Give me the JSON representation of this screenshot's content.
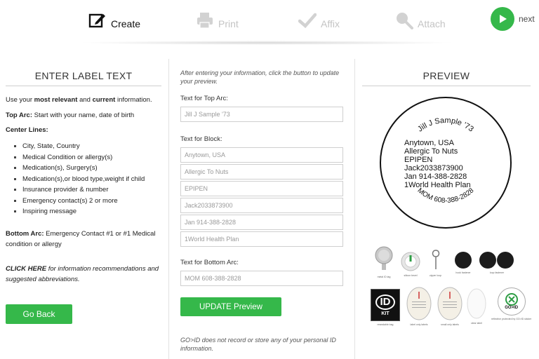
{
  "steps": [
    {
      "label": "Create",
      "icon": "edit-icon",
      "state": "active"
    },
    {
      "label": "Print",
      "icon": "printer-icon",
      "state": "inactive"
    },
    {
      "label": "Affix",
      "icon": "checkmark-icon",
      "state": "inactive"
    },
    {
      "label": "Attach",
      "icon": "magnifier-icon",
      "state": "inactive"
    }
  ],
  "next": {
    "label": "next",
    "icon": "play-arrow-icon",
    "color": "#35b84a"
  },
  "left": {
    "title": "ENTER LABEL TEXT",
    "intro": {
      "pre": "Use your ",
      "b1": "most relevant",
      "mid": " and ",
      "b2": "current",
      "post": " information."
    },
    "top_arc": {
      "label": "Top Arc:",
      "text": " Start with your name, date of birth"
    },
    "center_lines": {
      "label": "Center Lines:"
    },
    "bullets": [
      "City, State, Country",
      "Medical Condition or allergy(s)",
      "Medication(s), Surgery(s)",
      "Medication(s),or blood type,weight if child",
      "Insurance provider & number",
      "Emergency contact(s) 2 or more",
      "Inspiring message"
    ],
    "bottom_arc": {
      "label": "Bottom Arc:",
      "text": " Emergency Contact #1 or #1 Medical condition or allergy"
    },
    "click_here": {
      "link": "CLICK HERE",
      "text": " for information recommendations and suggested abbreviations."
    },
    "go_back": "Go Back"
  },
  "middle": {
    "note": "After entering your information, click the button to update your preview.",
    "top_arc_label": "Text for Top Arc:",
    "top_arc_value": "Jill J Sample '73",
    "block_label": "Text for Block:",
    "block_values": [
      "Anytown, USA",
      "Allergic To Nuts",
      "EPIPEN",
      "Jack2033873900",
      "Jan 914-388-2828",
      "1World Health Plan"
    ],
    "bottom_arc_label": "Text for Bottom Arc:",
    "bottom_arc_value": "MOM 608-388-2828",
    "update_button": "UPDATE Preview",
    "disclaimer": "GO>ID does not record or store any of your personal ID information."
  },
  "right": {
    "title": "PREVIEW",
    "label_preview": {
      "top_arc": "Jill J Sample '73",
      "lines": [
        "Anytown, USA",
        "Allergic To Nuts",
        "EPIPEN",
        "Jack2033873900",
        "Jan 914-388-2828",
        "1World Health Plan"
      ],
      "bottom_arc": "MOM 608-388-2828"
    },
    "products_row1": [
      {
        "caption": "metal ID tag",
        "icon": "metal-tag-icon"
      },
      {
        "caption": "silicon bezel",
        "icon": "bezel-icon"
      },
      {
        "caption": "zipper loop",
        "icon": "zipper-loop-icon"
      },
      {
        "caption": "hook fastener",
        "icon": "hook-fastener-icon"
      },
      {
        "caption": "loop fastener",
        "icon": "loop-fastener-icon"
      }
    ],
    "products_row2": [
      {
        "caption": "resealable bag",
        "icon": "id-kit-icon",
        "kit_text": "ID",
        "kit_sub": "KIT"
      },
      {
        "caption": "label only labels",
        "icon": "oval-label-icon"
      },
      {
        "caption": "small only labels",
        "icon": "oval-label-small-icon"
      },
      {
        "caption": "clear label",
        "icon": "clear-label-icon"
      },
      {
        "caption": "reflective protected by GO>ID sticker",
        "icon": "goid-sticker-icon",
        "badge_text": "GO>ID"
      }
    ]
  }
}
